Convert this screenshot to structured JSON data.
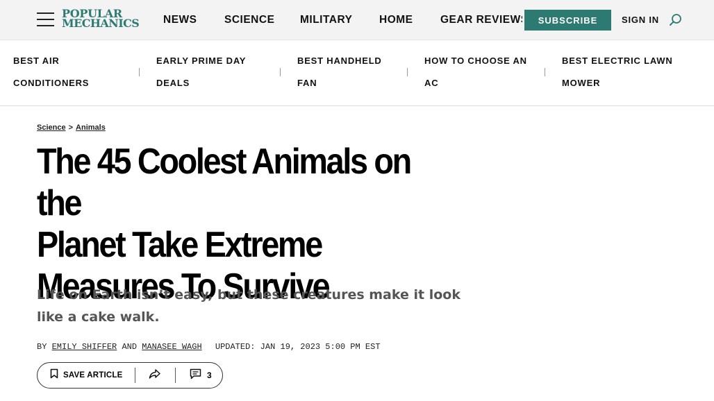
{
  "header": {
    "logo_line1": "POPULAR",
    "logo_line2": "MECHANICS",
    "nav": [
      "NEWS",
      "SCIENCE",
      "MILITARY",
      "HOME",
      "GEAR REVIEWS"
    ],
    "subscribe_label": "SUBSCRIBE",
    "signin_label": "SIGN IN",
    "icons": {
      "menu": "hamburger-menu-icon",
      "search": "search-icon"
    },
    "colors": {
      "brand": "#2d7a73",
      "header_bg": "#f3f3f3"
    }
  },
  "trending": [
    {
      "line1": "BEST AIR",
      "line2": "CONDITIONERS"
    },
    {
      "line1": "EARLY PRIME DAY",
      "line2": "DEALS"
    },
    {
      "line1": "BEST HANDHELD",
      "line2": "FAN"
    },
    {
      "line1": "HOW TO CHOOSE AN",
      "line2": "AC"
    },
    {
      "line1": "BEST ELECTRIC LAWN",
      "line2": "MOWER"
    }
  ],
  "article": {
    "breadcrumb": {
      "section": "Science",
      "separator": ">",
      "subsection": "Animals"
    },
    "headline_lines": [
      "The 45 Coolest Animals on the",
      "Planet Take Extreme",
      "Measures To Survive"
    ],
    "dek": "Life on Earth isn’t easy, but these creatures make it look like a cake walk.",
    "byline": {
      "prefix": "BY",
      "author1": "EMILY SHIFFER",
      "conjunction": "AND",
      "author2": "MANASEE WAGH",
      "updated": "UPDATED: JAN 19, 2023 5:00 PM EST"
    },
    "actions": {
      "save_label": "SAVE ARTICLE",
      "comment_count": "3",
      "icons": {
        "save": "bookmark-icon",
        "share": "share-icon",
        "comments": "comment-icon"
      }
    }
  }
}
